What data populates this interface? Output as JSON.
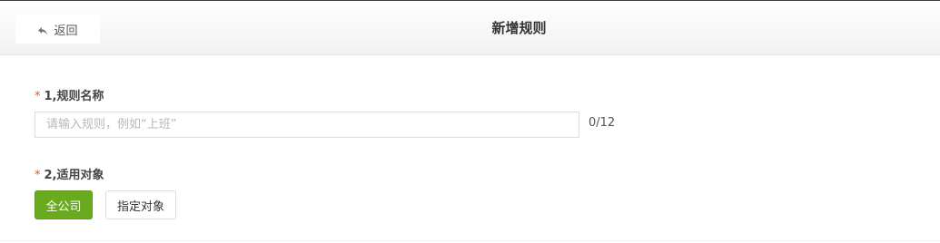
{
  "header": {
    "back_label": "返回",
    "back_icon": "reply-arrow-icon",
    "title": "新增规则"
  },
  "form": {
    "required_mark": "*",
    "rule_name": {
      "label": "1,规则名称",
      "value": "",
      "placeholder": "请输入规则，例如“上班”",
      "counter": "0/12"
    },
    "target": {
      "label": "2,适用对象",
      "options": [
        {
          "label": "全公司",
          "selected": true
        },
        {
          "label": "指定对象",
          "selected": false
        }
      ]
    }
  },
  "colors": {
    "accent_green": "#6aaa1f",
    "required_red": "#e8541e"
  }
}
